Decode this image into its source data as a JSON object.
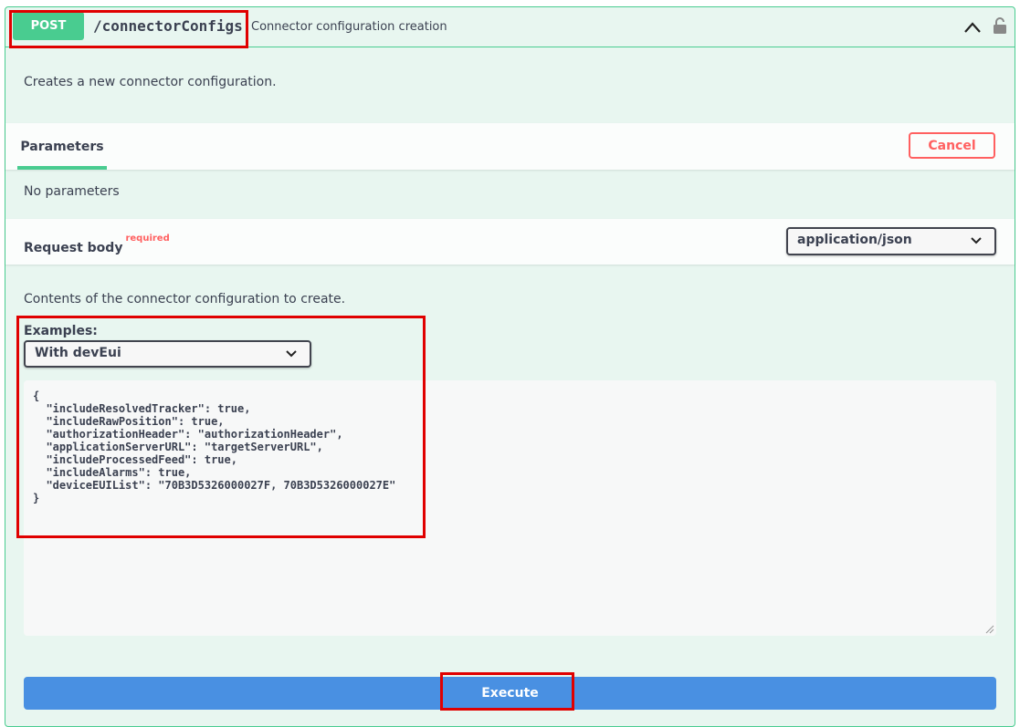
{
  "operation": {
    "method": "POST",
    "path": "/connectorConfigs",
    "summary": "Connector configuration creation",
    "description": "Creates a new connector configuration."
  },
  "parameters": {
    "tab_label": "Parameters",
    "cancel_label": "Cancel",
    "empty_text": "No parameters"
  },
  "request_body": {
    "title": "Request body",
    "required_label": "required",
    "content_type": "application/json",
    "description": "Contents of the connector configuration to create.",
    "examples_label": "Examples:",
    "example_selected": "With devEui",
    "body": "{\n  \"includeResolvedTracker\": true,\n  \"includeRawPosition\": true,\n  \"authorizationHeader\": \"authorizationHeader\",\n  \"applicationServerURL\": \"targetServerURL\",\n  \"includeProcessedFeed\": true,\n  \"includeAlarms\": true,\n  \"deviceEUIList\": \"70B3D5326000027F, 70B3D5326000027E\"\n}"
  },
  "execute_label": "Execute",
  "colors": {
    "post_green": "#49cc90",
    "execute_blue": "#4990e2",
    "cancel_red": "#ff6060",
    "highlight_red": "#e00000"
  }
}
